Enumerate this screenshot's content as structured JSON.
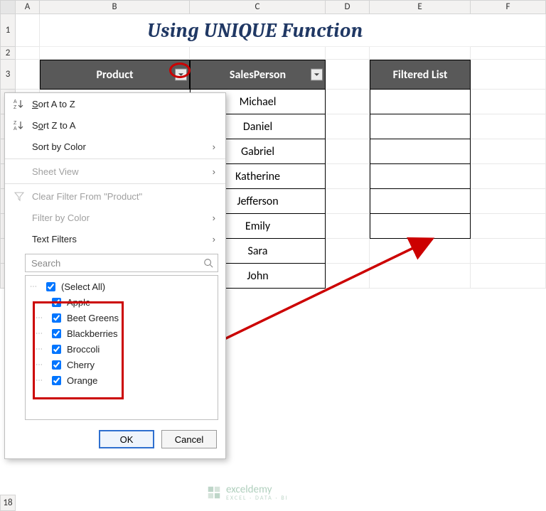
{
  "columns": [
    "A",
    "B",
    "C",
    "D",
    "E",
    "F"
  ],
  "row18_label": "18",
  "title": "Using UNIQUE Function",
  "headers": {
    "product": "Product",
    "salesperson": "SalesPerson",
    "filtered": "Filtered List"
  },
  "salespersons": [
    "Michael",
    "Daniel",
    "Gabriel",
    "Katherine",
    "Jefferson",
    "Emily",
    "Sara",
    "John"
  ],
  "menu": {
    "sort_az": "Sort A to Z",
    "sort_za": "Sort Z to A",
    "sort_color": "Sort by Color",
    "sheet_view": "Sheet View",
    "clear_filter": "Clear Filter From \"Product\"",
    "filter_color": "Filter by Color",
    "text_filters": "Text Filters",
    "search_placeholder": "Search",
    "items": [
      "(Select All)",
      "Apple",
      "Beet Greens",
      "Blackberries",
      "Broccoli",
      "Cherry",
      "Orange"
    ],
    "ok": "OK",
    "cancel": "Cancel"
  },
  "rows_visible": [
    "1",
    "2",
    "3"
  ],
  "watermark": {
    "name": "exceldemy",
    "tag": "EXCEL · DATA · BI"
  }
}
